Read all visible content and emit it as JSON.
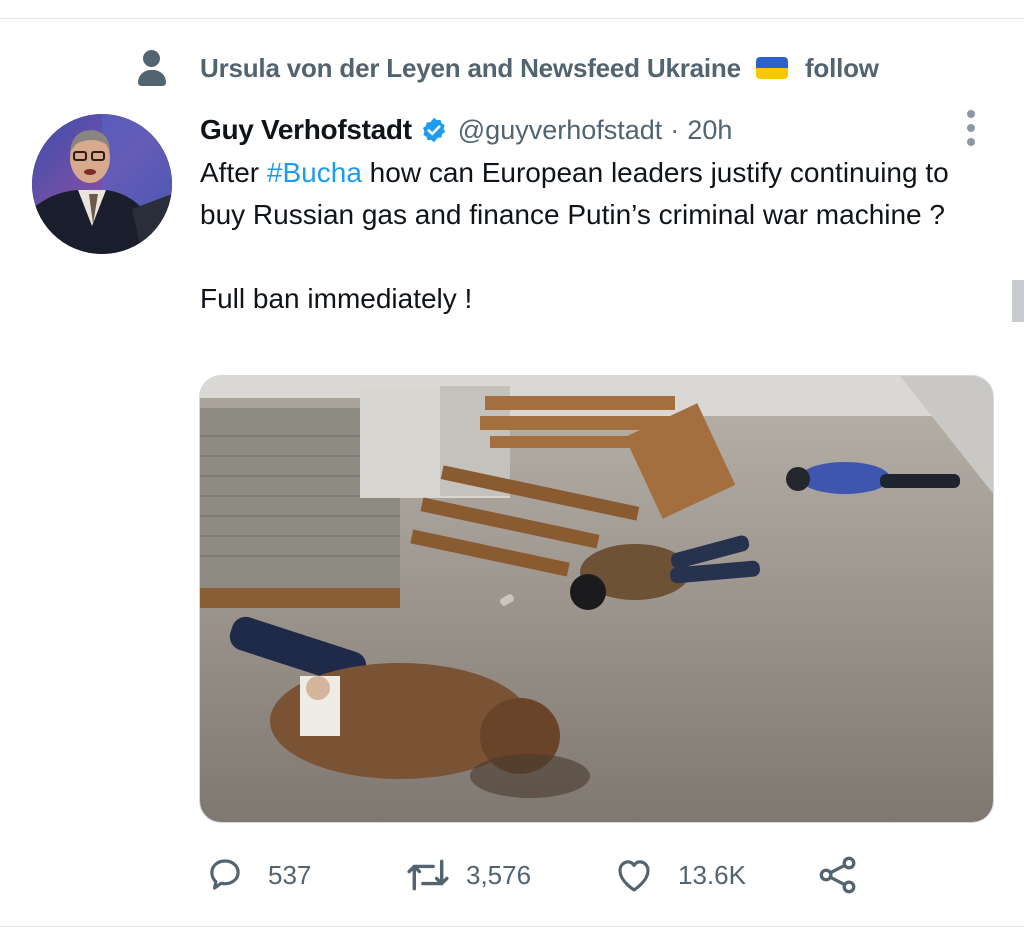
{
  "social_context": {
    "text": "Ursula von der Leyen and Newsfeed Ukraine",
    "follow_label": "follow"
  },
  "tweet": {
    "display_name": "Guy Verhofstadt",
    "handle": "@guyverhofstadt",
    "separator": "·",
    "time": "20h",
    "text": {
      "before_hashtag": "After ",
      "hashtag": "#Bucha",
      "after_hashtag": " how can European leaders justify continuing to buy Russian gas and finance Putin’s criminal war machine ?",
      "second_paragraph": "Full ban immediately !"
    }
  },
  "actions": {
    "replies": "537",
    "retweets": "3,576",
    "likes": "13.6K"
  },
  "icons": {
    "social_context": "person-icon",
    "verified": "verified-badge-icon",
    "more": "more-vertical-icon",
    "reply": "reply-icon",
    "retweet": "retweet-icon",
    "like": "heart-icon",
    "share": "share-icon"
  },
  "colors": {
    "accent": "#1d9bf0",
    "secondary_text": "#536471",
    "primary_text": "#0f1419",
    "flag_blue": "#2a62c9",
    "flag_yellow": "#f7c800"
  }
}
